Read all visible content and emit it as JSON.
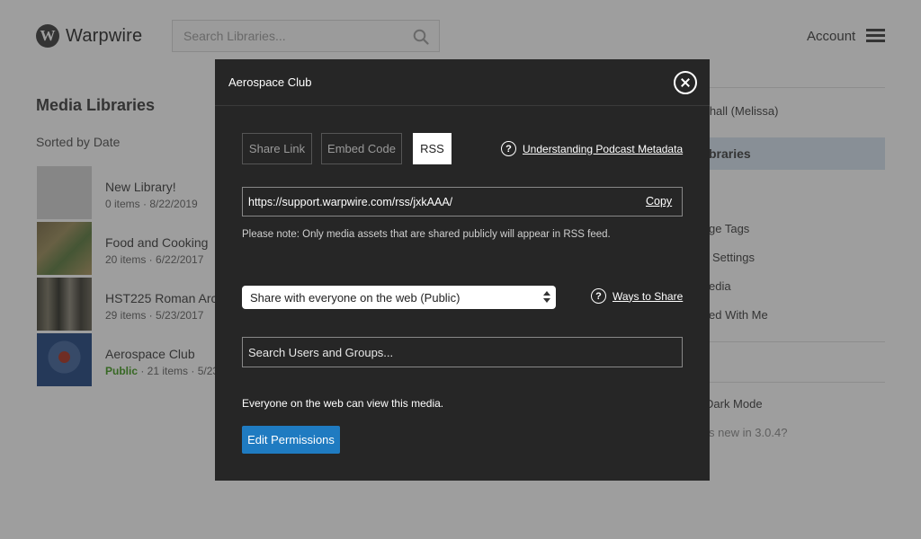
{
  "header": {
    "logo_letter": "W",
    "logo_text": "Warpwire",
    "search_placeholder": "Search Libraries...",
    "account_label": "Account"
  },
  "main": {
    "title": "Media Libraries",
    "sort_label": "Sorted by Date",
    "libraries": [
      {
        "name": "New Library!",
        "meta": "0 items · 8/22/2019",
        "public": ""
      },
      {
        "name": "Food and Cooking",
        "meta": "20 items · 6/22/2017",
        "public": ""
      },
      {
        "name": "HST225 Roman Arc",
        "meta": "29 items · 5/23/2017",
        "public": ""
      },
      {
        "name": "Aerospace Club",
        "meta": " · 21 items · 5/23",
        "public": "Public"
      }
    ]
  },
  "right_panel": {
    "user_name": "rshall (Melissa)",
    "libraries_heading": "braries",
    "items": [
      "ge Tags",
      "Settings",
      "edia",
      "ed With Me"
    ],
    "dark_mode": "Dark Mode",
    "whats_new": "s new in 3.0.4?"
  },
  "modal": {
    "title": "Aerospace Club",
    "tabs": [
      "Share Link",
      "Embed Code",
      "RSS"
    ],
    "active_tab": "RSS",
    "podcast_help": "Understanding Podcast Metadata",
    "help_glyph": "?",
    "rss_url": "https://support.warpwire.com/rss/jxkAAA/",
    "copy_label": "Copy",
    "note": "Please note: Only media assets that are shared publicly will appear in RSS feed.",
    "share_select": "Share with everyone on the web (Public)",
    "ways_help": "Ways to Share",
    "user_search_placeholder": "Search Users and Groups...",
    "visibility_text": "Everyone on the web can view this media.",
    "edit_button": "Edit Permissions"
  },
  "colors": {
    "modal_bg": "#262626",
    "primary_button": "#1f7bc1",
    "public_badge": "#5aa83a",
    "sidebar_highlight": "#dbe7f3"
  },
  "icons": {
    "close": "close-circle-icon",
    "help": "question-circle-icon",
    "search": "search-icon",
    "menu": "hamburger-menu-icon"
  }
}
